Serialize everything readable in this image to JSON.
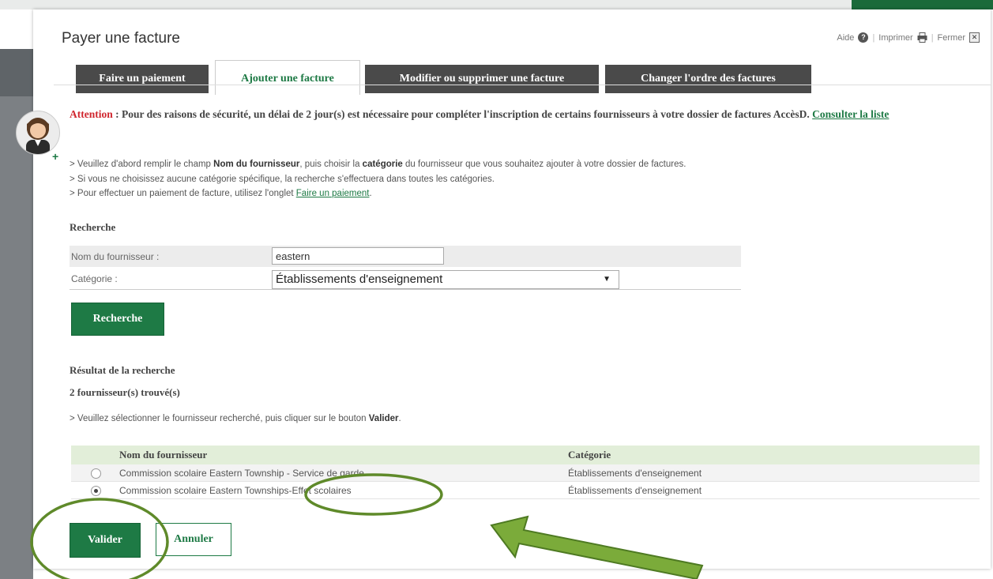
{
  "dialog": {
    "title": "Payer une facture",
    "help_label": "Aide",
    "print_label": "Imprimer",
    "close_label": "Fermer",
    "separator": "|"
  },
  "tabs": [
    {
      "label": "Faire un paiement",
      "active": false
    },
    {
      "label": "Ajouter une facture",
      "active": true
    },
    {
      "label": "Modifier ou supprimer une facture",
      "active": false
    },
    {
      "label": "Changer l'ordre des factures",
      "active": false
    }
  ],
  "notice": {
    "attention_label": "Attention",
    "text": " : Pour des raisons de sécurité, un délai de 2 jour(s) est nécessaire pour compléter l'inscription de certains fournisseurs à votre dossier de factures AccèsD. ",
    "link": "Consulter la liste"
  },
  "instructions": {
    "line1_pre": "> Veuillez d'abord remplir le champ ",
    "line1_b1": "Nom du fournisseur",
    "line1_mid": ", puis choisir la ",
    "line1_b2": "catégorie",
    "line1_post": " du fournisseur que vous souhaitez ajouter à votre dossier de factures.",
    "line2": "> Si vous ne choisissez aucune catégorie spécifique, la recherche s'effectuera dans toutes les catégories.",
    "line3_pre": "> Pour effectuer un paiement de facture, utilisez l'onglet ",
    "line3_link": "Faire un paiement",
    "line3_post": "."
  },
  "search": {
    "heading": "Recherche",
    "supplier_label": "Nom du fournisseur :",
    "supplier_value": "eastern",
    "category_label": "Catégorie :",
    "category_value": "Établissements d'enseignement",
    "button": "Recherche"
  },
  "results": {
    "heading": "Résultat de la recherche",
    "count": "2 fournisseur(s) trouvé(s)",
    "instr_pre": "> Veuillez sélectionner le fournisseur recherché, puis cliquer sur le bouton ",
    "instr_b": "Valider",
    "instr_post": ".",
    "col_name": "Nom du fournisseur",
    "col_category": "Catégorie",
    "rows": [
      {
        "name": "Commission scolaire Eastern Township - Service de garde",
        "category": "Établissements d'enseignement",
        "selected": false
      },
      {
        "name": "Commission scolaire Eastern Townships-Effet scolaires",
        "category": "Établissements d'enseignement",
        "selected": true
      }
    ]
  },
  "actions": {
    "validate": "Valider",
    "cancel": "Annuler"
  },
  "colors": {
    "brand_green": "#1e7a45",
    "tab_dark": "#4a4a4a",
    "annotation_green": "#7bab3a",
    "annotation_ring": "#5f8a2a"
  }
}
